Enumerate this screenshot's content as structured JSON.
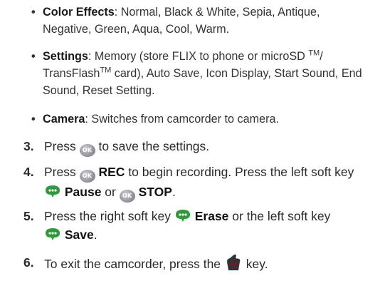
{
  "bullets": [
    {
      "title": "Color Effects",
      "text": ": Normal, Black & White, Sepia, Antique,",
      "text2": "Negative, Green, Aqua, Cool, Warm."
    },
    {
      "title": "Settings",
      "text": ": Memory (store FLIX to phone or microSD ",
      "tm1": "TM",
      "slash": "/",
      "text2a": "TransFlash",
      "tm2": "TM",
      "text2b": " card), Auto Save, Icon Display, Start Sound, End",
      "text3": "Sound, Reset Setting."
    },
    {
      "title": "Camera",
      "text": ": Switches from camcorder to camera."
    }
  ],
  "steps": [
    {
      "num": "3.",
      "pre": "Press ",
      "post": " to save the settings."
    },
    {
      "num": "4.",
      "pre": "Press ",
      "bold1": "REC",
      "mid": " to begin recording. Press the left soft key",
      "bold2": "Pause",
      "or": " or ",
      "bold3": "STOP",
      "end": "."
    },
    {
      "num": "5.",
      "pre": "Press the right soft key ",
      "bold1": "Erase",
      "mid": " or the left soft key",
      "bold2": "Save",
      "end": "."
    },
    {
      "num": "6.",
      "pre": "To exit the camcorder, press the ",
      "post": " key."
    }
  ],
  "icons": {
    "ok_label": "OK",
    "ok_icon": "ok-button-icon",
    "softkey_icon": "softkey-icon",
    "end_icon": "end-key-icon",
    "softkey_color": "#2f9a3a",
    "end_color": "#8a1020"
  }
}
